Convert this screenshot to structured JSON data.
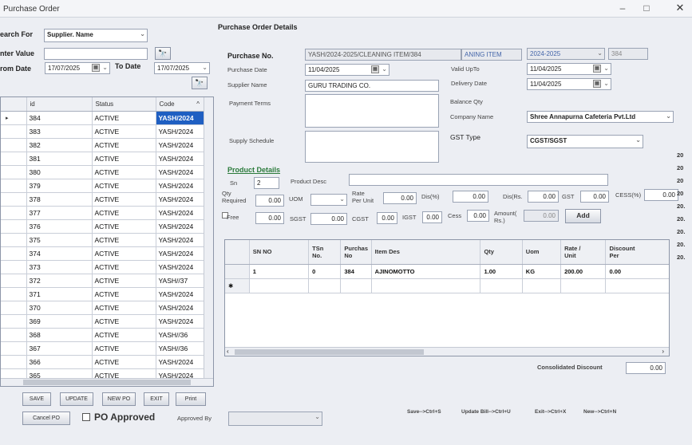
{
  "window": {
    "title": "Purchase Order",
    "minimize": "–",
    "maximize": "□",
    "close": "✕"
  },
  "search": {
    "search_for_label": "earch For",
    "search_for_value": "Supplier. Name",
    "enter_value_label": "nter Value",
    "enter_value": "",
    "from_date_label": "rom Date",
    "from_date": "17/07/2025",
    "to_date_label": "To Date",
    "to_date": "17/07/2025"
  },
  "list": {
    "columns": [
      "id",
      "Status",
      "Code"
    ],
    "rows": [
      {
        "id": "384",
        "status": "ACTIVE",
        "code": "YASH/2024"
      },
      {
        "id": "383",
        "status": "ACTIVE",
        "code": "YASH/2024"
      },
      {
        "id": "382",
        "status": "ACTIVE",
        "code": "YASH/2024"
      },
      {
        "id": "381",
        "status": "ACTIVE",
        "code": "YASH/2024"
      },
      {
        "id": "380",
        "status": "ACTIVE",
        "code": "YASH/2024"
      },
      {
        "id": "379",
        "status": "ACTIVE",
        "code": "YASH/2024"
      },
      {
        "id": "378",
        "status": "ACTIVE",
        "code": "YASH/2024"
      },
      {
        "id": "377",
        "status": "ACTIVE",
        "code": "YASH/2024"
      },
      {
        "id": "376",
        "status": "ACTIVE",
        "code": "YASH/2024"
      },
      {
        "id": "375",
        "status": "ACTIVE",
        "code": "YASH/2024"
      },
      {
        "id": "374",
        "status": "ACTIVE",
        "code": "YASH/2024"
      },
      {
        "id": "373",
        "status": "ACTIVE",
        "code": "YASH/2024"
      },
      {
        "id": "372",
        "status": "ACTIVE",
        "code": "YASH//37"
      },
      {
        "id": "371",
        "status": "ACTIVE",
        "code": "YASH/2024"
      },
      {
        "id": "370",
        "status": "ACTIVE",
        "code": "YASH/2024"
      },
      {
        "id": "369",
        "status": "ACTIVE",
        "code": "YASH/2024"
      },
      {
        "id": "368",
        "status": "ACTIVE",
        "code": "YASH//36"
      },
      {
        "id": "367",
        "status": "ACTIVE",
        "code": "YASH//36"
      },
      {
        "id": "366",
        "status": "ACTIVE",
        "code": "YASH/2024"
      },
      {
        "id": "365",
        "status": "ACTIVE",
        "code": "YASH/2024"
      }
    ]
  },
  "details": {
    "section_title": "Purchase Order Details",
    "purchase_no_label": "Purchase No.",
    "purchase_no": "YASH/2024-2025/CLEANING ITEM/384",
    "item_type": "ANING ITEM",
    "fin_year": "2024-2025",
    "po_id": "384",
    "purchase_date_label": "Purchase Date",
    "purchase_date": "11/04/2025",
    "valid_upto_label": "Valid UpTo",
    "valid_upto": "11/04/2025",
    "supplier_name_label": "Supplier Name",
    "supplier_name": "GURU TRADING CO.",
    "delivery_date_label": "Delivery Date",
    "delivery_date": "11/04/2025",
    "payment_terms_label": "Payment Terms",
    "balance_qty_label": "Balance Qty",
    "company_name_label": "Company Name",
    "company_name": "Shree Annapurna Cafeteria Pvt.Ltd",
    "supply_schedule_label": "Supply Schedule",
    "gst_type_label": "GST Type",
    "gst_type": "CGST/SGST"
  },
  "product": {
    "section_title": "Product Details",
    "sn_label": "Sn",
    "sn_value": "2",
    "product_desc_label": "Product Desc",
    "qty_required_label": "Qty\nRequired",
    "qty_required": "0.00",
    "uom_label": "UOM",
    "rate_label": "Rate\nPer Unit",
    "rate": "0.00",
    "dis_pct_label": "Dis(%)",
    "dis_pct": "0.00",
    "dis_rs_label": "Dis(Rs.",
    "dis_rs": "0.00",
    "gst_label": "GST",
    "gst": "0.00",
    "cess_pct_label": "CESS(%)",
    "cess_pct": "0.00",
    "free_label": "Free",
    "free": "0.00",
    "sgst_label": "SGST",
    "sgst": "0.00",
    "cgst_label": "CGST",
    "cgst": "0.00",
    "igst_label": "IGST",
    "igst": "0.00",
    "cess_label": "Cess",
    "cess": "0.00",
    "amount_label": "Amount(\nRs.)",
    "amount": "0.00",
    "add_label": "Add"
  },
  "items": {
    "columns": [
      "SN NO",
      "TSn\nNo.",
      "Purchas\nNo",
      "Item Des",
      "Qty",
      "Uom",
      "Rate /\nUnit",
      "Discount\nPer"
    ],
    "rows": [
      {
        "sn": "1",
        "tsn": "0",
        "purchase_no": "384",
        "item": "AJINOMOTTO",
        "qty": "1.00",
        "uom": "KG",
        "rate": "200.00",
        "discount": "0.00"
      }
    ]
  },
  "footer": {
    "consolidated_discount_label": "Consolidated Discount",
    "consolidated_discount": "0.00",
    "save_label": "SAVE",
    "update_label": "UPDATE",
    "new_po_label": "NEW PO",
    "exit_label": "EXIT",
    "print_label": "Print",
    "cancel_po_label": "Cancel PO",
    "po_approved_label": "PO Approved",
    "approved_by_label": "Approved By",
    "hint_save": "Save-->Ctrl+S",
    "hint_update": "Update Bill-->Ctrl+U",
    "hint_exit": "Exit-->Ctrl+X",
    "hint_new": "New-->Ctrl+N"
  },
  "edge_strip": [
    "20",
    "20",
    "20",
    "20",
    "20.",
    "20.",
    "20.",
    "20.",
    "20."
  ]
}
